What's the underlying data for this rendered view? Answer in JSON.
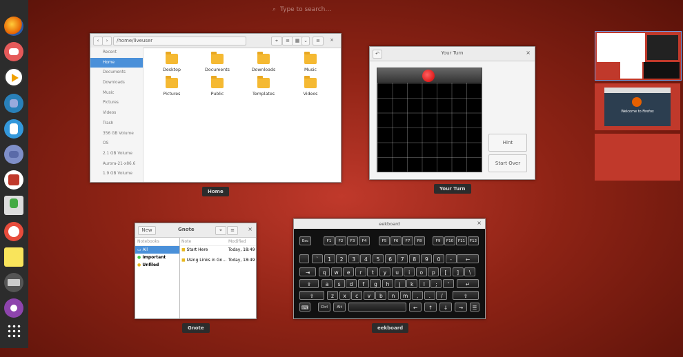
{
  "search": {
    "placeholder": "Type to search…"
  },
  "dash": {
    "items": [
      "firefox-icon",
      "mail-icon",
      "video-icon",
      "photos-icon",
      "documents-icon",
      "files-icon",
      "software-icon",
      "install-icon",
      "recorder-icon",
      "notes-icon",
      "keyboard-icon",
      "games-icon",
      "show-apps-icon"
    ]
  },
  "files": {
    "path": "/home/liveuser",
    "label": "Home",
    "sidebar": [
      "Recent",
      "Home",
      "Documents",
      "Downloads",
      "Music",
      "Pictures",
      "Videos",
      "Trash",
      "356 GB Volume",
      "OS",
      "2.1 GB Volume",
      "Aurora-21-x86.6",
      "1.9 GB Volume"
    ],
    "folders": [
      "Desktop",
      "Documents",
      "Downloads",
      "Music",
      "Pictures",
      "Public",
      "Templates",
      "Videos"
    ]
  },
  "game": {
    "title": "Your Turn",
    "label": "Your Turn",
    "hint": "Hint",
    "start_over": "Start Over"
  },
  "gnote": {
    "title": "Gnote",
    "label": "Gnote",
    "new": "New",
    "notebooks_header": "Notebooks",
    "note_header": "Note",
    "modified_header": "Modified",
    "notebooks": [
      "All",
      "Important",
      "Unfiled"
    ],
    "notes": [
      {
        "title": "Start Here",
        "modified": "Today, 18:49"
      },
      {
        "title": "Using Links in Gn…",
        "modified": "Today, 18:49"
      }
    ]
  },
  "keyboard": {
    "title": "eekboard",
    "label": "eekboard",
    "row0": [
      "Esc",
      "F1",
      "F2",
      "F3",
      "F4",
      "F5",
      "F6",
      "F7",
      "F8",
      "F9",
      "F10",
      "F11",
      "F12"
    ],
    "row1": [
      "`",
      "1",
      "2",
      "3",
      "4",
      "5",
      "6",
      "7",
      "8",
      "9",
      "0",
      "-",
      "="
    ],
    "row2": [
      "q",
      "w",
      "e",
      "r",
      "t",
      "y",
      "u",
      "i",
      "o",
      "p",
      "[",
      "]",
      "\\"
    ],
    "row3": [
      "a",
      "s",
      "d",
      "f",
      "g",
      "h",
      "j",
      "k",
      "l",
      ";",
      "'"
    ],
    "row4": [
      "z",
      "x",
      "c",
      "v",
      "b",
      "n",
      "m",
      ",",
      ".",
      "/"
    ],
    "ctrl": "Ctrl",
    "alt": "Alt"
  },
  "workspaces": {
    "welcome": "Welcome to Firefox"
  }
}
